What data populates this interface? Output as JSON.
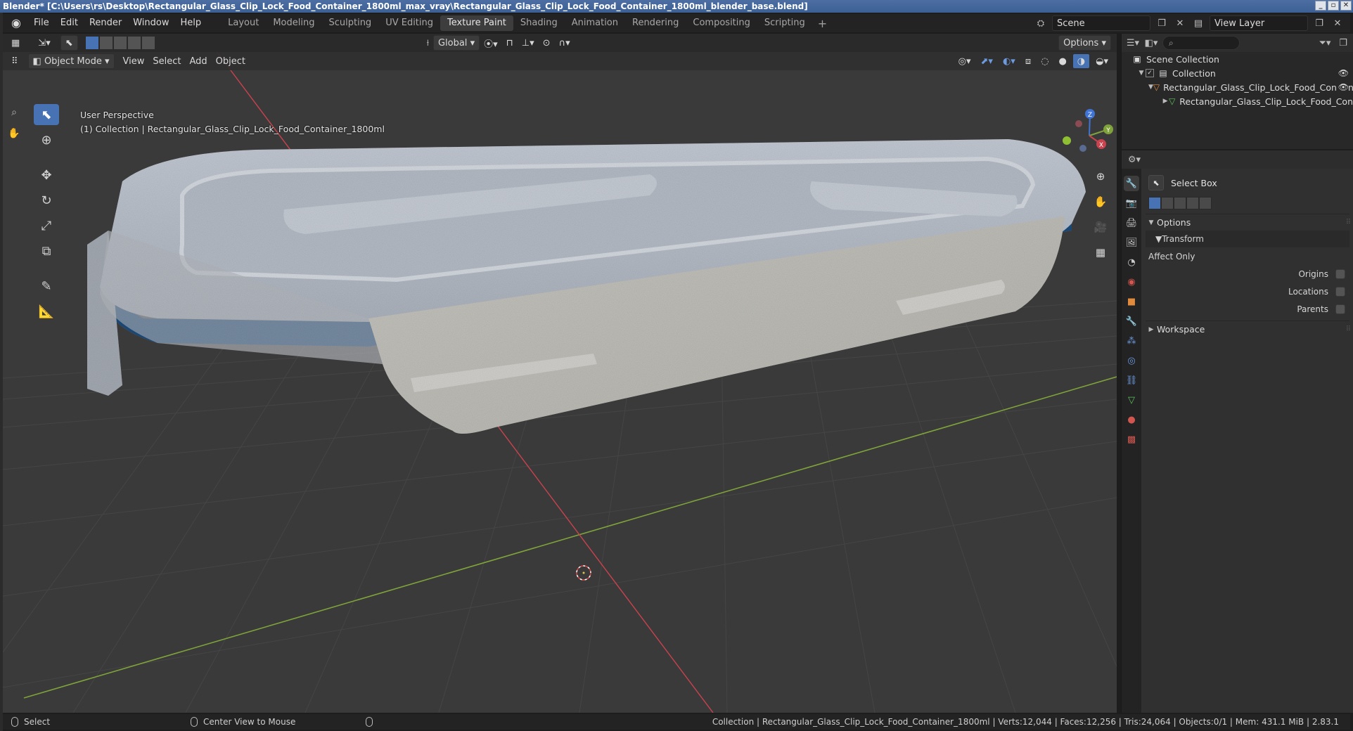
{
  "titlebar": {
    "title": "Blender* [C:\\Users\\rs\\Desktop\\Rectangular_Glass_Clip_Lock_Food_Container_1800ml_max_vray\\Rectangular_Glass_Clip_Lock_Food_Container_1800ml_blender_base.blend]",
    "minimize": "_",
    "maximize": "▫",
    "close": "✕"
  },
  "menu": {
    "items": [
      "File",
      "Edit",
      "Render",
      "Window",
      "Help"
    ]
  },
  "workspaces": {
    "tabs": [
      "Layout",
      "Modeling",
      "Sculpting",
      "UV Editing",
      "Texture Paint",
      "Shading",
      "Animation",
      "Rendering",
      "Compositing",
      "Scripting"
    ],
    "active": "Texture Paint",
    "add": "+"
  },
  "scene": {
    "name": "Scene",
    "view_layer": "View Layer"
  },
  "viewport": {
    "mode": "Object Mode",
    "menus": [
      "View",
      "Select",
      "Add",
      "Object"
    ],
    "transform_orientation": "Global",
    "options": "Options",
    "perspective": "User Perspective",
    "collection_info": "(1) Collection | Rectangular_Glass_Clip_Lock_Food_Container_1800ml",
    "gizmo_axes": {
      "x": "X",
      "y": "Y",
      "z": "Z"
    }
  },
  "outliner": {
    "search_placeholder": "",
    "rows": {
      "scene_collection": "Scene Collection",
      "collection": "Collection",
      "object": "Rectangular_Glass_Clip_Lock_Food_Contain",
      "mesh": "Rectangular_Glass_Clip_Lock_Food_Con"
    }
  },
  "properties": {
    "tool_name": "Select Box",
    "options_label": "Options",
    "transform_label": "Transform",
    "affect_only": "Affect Only",
    "origins": "Origins",
    "locations": "Locations",
    "parents": "Parents",
    "workspace_label": "Workspace"
  },
  "statusbar": {
    "select": "Select",
    "center_view": "Center View to Mouse",
    "stats": "Collection | Rectangular_Glass_Clip_Lock_Food_Container_1800ml | Verts:12,044 | Faces:12,256 | Tris:24,064 | Objects:0/1 | Mem: 431.1 MiB | 2.83.1"
  },
  "colors": {
    "accent": "#4772b3",
    "viewport_bg": "#3a3a3a",
    "x_axis": "#c8434e",
    "y_axis": "#7fa33a",
    "z_axis": "#3f74d6",
    "lid_seal": "#1c4c7c"
  }
}
